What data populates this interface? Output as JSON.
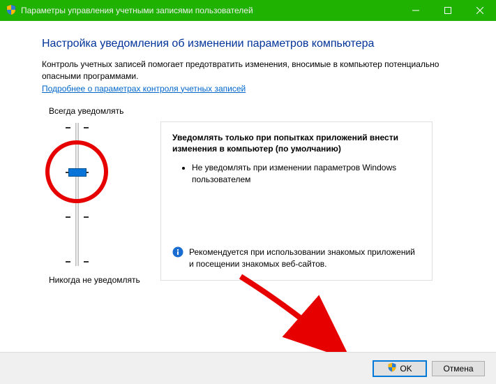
{
  "titlebar": {
    "title": "Параметры управления учетными записями пользователей"
  },
  "heading": "Настройка уведомления об изменении параметров компьютера",
  "description": "Контроль учетных записей помогает предотвратить изменения, вносимые в компьютер потенциально опасными программами.",
  "link_text": "Подробнее о параметрах контроля учетных записей",
  "slider": {
    "top_label": "Всегда уведомлять",
    "bottom_label": "Никогда не уведомлять",
    "levels": 4,
    "selected_index": 1
  },
  "info": {
    "title": "Уведомлять только при попытках приложений внести изменения в компьютер (по умолчанию)",
    "bullet": "Не уведомлять при изменении параметров Windows пользователем",
    "recommendation": "Рекомендуется при использовании знакомых приложений и посещении знакомых веб-сайтов."
  },
  "buttons": {
    "ok": "OK",
    "cancel": "Отмена"
  }
}
